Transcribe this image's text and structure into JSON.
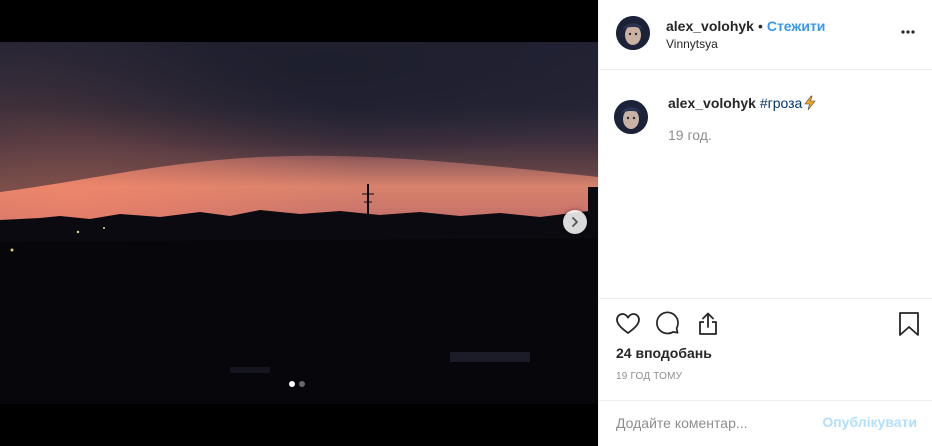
{
  "post": {
    "username": "alex_volohyk",
    "follow_label": "Стежити",
    "separator": "•",
    "location": "Vinnytsya",
    "caption_hashtag": "#гроза",
    "caption_time": "19 год.",
    "likes": "24 вподобань",
    "posted_ago": "19 ГОД ТОМУ"
  },
  "media": {
    "slides_total": 2,
    "active_slide": 1,
    "next_icon": "chevron-right-icon"
  },
  "comment": {
    "placeholder": "Додайте коментар...",
    "publish_label": "Опублікувати"
  },
  "colors": {
    "accent": "#3897f0",
    "hashtag": "#003569",
    "publish_disabled": "#b2dffc",
    "lightning": "#f5a623"
  }
}
